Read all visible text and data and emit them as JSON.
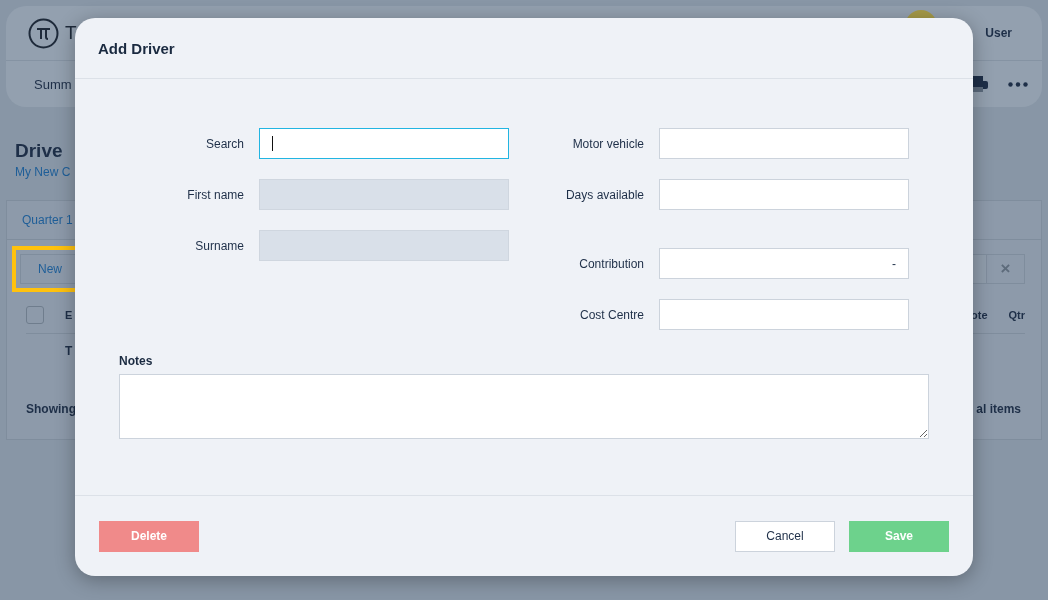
{
  "header": {
    "logo_text": "T",
    "user_name": "User"
  },
  "nav": {
    "tab": "Summ"
  },
  "page": {
    "title": "Drive",
    "subtitle": "My New C"
  },
  "card": {
    "tabs": [
      {
        "label": "Quarter 1",
        "selected": true
      }
    ],
    "new_button": {
      "label": "New",
      "highlighted": true
    },
    "clear_button": "×",
    "select_all": {
      "checked": false
    },
    "columns": [
      "E",
      "ote",
      "Qtr"
    ],
    "row_cell": "T",
    "footer_left": "Showing",
    "footer_right": "al items"
  },
  "dialog": {
    "title": "Add Driver",
    "left_fields": [
      {
        "label": "Search",
        "focused": true,
        "disabled": false
      },
      {
        "label": "First name",
        "focused": false,
        "disabled": true
      },
      {
        "label": "Surname",
        "focused": false,
        "disabled": true
      }
    ],
    "right_fields": [
      {
        "label": "Motor vehicle",
        "focused": false,
        "disabled": false
      },
      {
        "label": "Days available",
        "focused": false,
        "disabled": false
      },
      {
        "label": "Contribution",
        "value": "-",
        "focused": false,
        "disabled": false
      },
      {
        "label": "Cost Centre",
        "focused": false,
        "disabled": false
      }
    ],
    "notes": {
      "label": "Notes"
    },
    "buttons": [
      {
        "label": "Delete",
        "kind": "danger"
      },
      {
        "label": "Cancel",
        "kind": "secondary"
      },
      {
        "label": "Save",
        "kind": "primary"
      }
    ]
  }
}
